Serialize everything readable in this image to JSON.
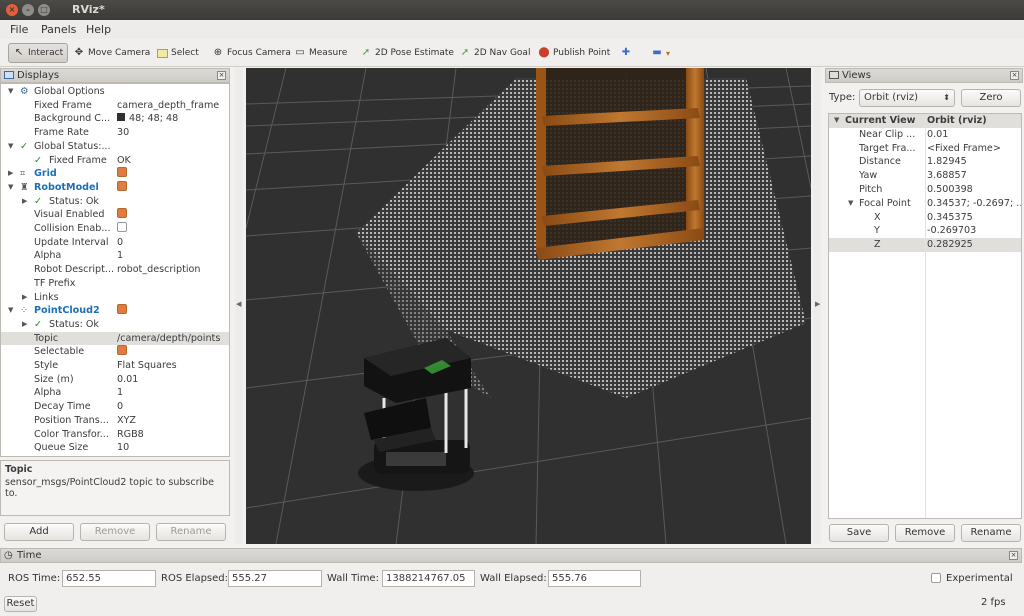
{
  "window": {
    "title": "RViz*"
  },
  "menu": [
    "File",
    "Panels",
    "Help"
  ],
  "toolbar": {
    "interact": "Interact",
    "move_camera": "Move Camera",
    "select": "Select",
    "focus_camera": "Focus Camera",
    "measure": "Measure",
    "pose_estimate": "2D Pose Estimate",
    "nav_goal": "2D Nav Goal",
    "publish_point": "Publish Point"
  },
  "displays": {
    "title": "Displays",
    "rows": [
      {
        "label": "Global Options",
        "value": ""
      },
      {
        "label": "Fixed Frame",
        "value": "camera_depth_frame"
      },
      {
        "label": "Background C...",
        "value": "48; 48; 48"
      },
      {
        "label": "Frame Rate",
        "value": "30"
      },
      {
        "label": "Global Status:...",
        "value": ""
      },
      {
        "label": "Fixed Frame",
        "value": "OK"
      },
      {
        "label": "Grid",
        "value": ""
      },
      {
        "label": "RobotModel",
        "value": ""
      },
      {
        "label": "Status: Ok",
        "value": ""
      },
      {
        "label": "Visual Enabled",
        "value": ""
      },
      {
        "label": "Collision Enab...",
        "value": ""
      },
      {
        "label": "Update Interval",
        "value": "0"
      },
      {
        "label": "Alpha",
        "value": "1"
      },
      {
        "label": "Robot Descript...",
        "value": "robot_description"
      },
      {
        "label": "TF Prefix",
        "value": ""
      },
      {
        "label": "Links",
        "value": ""
      },
      {
        "label": "PointCloud2",
        "value": ""
      },
      {
        "label": "Status: Ok",
        "value": ""
      },
      {
        "label": "Topic",
        "value": "/camera/depth/points"
      },
      {
        "label": "Selectable",
        "value": ""
      },
      {
        "label": "Style",
        "value": "Flat Squares"
      },
      {
        "label": "Size (m)",
        "value": "0.01"
      },
      {
        "label": "Alpha",
        "value": "1"
      },
      {
        "label": "Decay Time",
        "value": "0"
      },
      {
        "label": "Position Trans...",
        "value": "XYZ"
      },
      {
        "label": "Color Transfor...",
        "value": "RGB8"
      },
      {
        "label": "Queue Size",
        "value": "10"
      }
    ],
    "desc_title": "Topic",
    "desc_text": "sensor_msgs/PointCloud2 topic to subscribe to.",
    "buttons": {
      "add": "Add",
      "remove": "Remove",
      "rename": "Rename"
    }
  },
  "views": {
    "title": "Views",
    "type_label": "Type:",
    "type_value": "Orbit (rviz)",
    "zero": "Zero",
    "rows": [
      {
        "label": "Current View",
        "value": "Orbit (rviz)"
      },
      {
        "label": "Near Clip ...",
        "value": "0.01"
      },
      {
        "label": "Target Fra...",
        "value": "<Fixed Frame>"
      },
      {
        "label": "Distance",
        "value": "1.82945"
      },
      {
        "label": "Yaw",
        "value": "3.68857"
      },
      {
        "label": "Pitch",
        "value": "0.500398"
      },
      {
        "label": "Focal Point",
        "value": "0.34537; -0.2697; ..."
      },
      {
        "label": "X",
        "value": "0.345375"
      },
      {
        "label": "Y",
        "value": "-0.269703"
      },
      {
        "label": "Z",
        "value": "0.282925"
      }
    ],
    "buttons": {
      "save": "Save",
      "remove": "Remove",
      "rename": "Rename"
    }
  },
  "time": {
    "title": "Time",
    "ros_time_label": "ROS Time:",
    "ros_time": "652.55",
    "ros_elapsed_label": "ROS Elapsed:",
    "ros_elapsed": "555.27",
    "wall_time_label": "Wall Time:",
    "wall_time": "1388214767.05",
    "wall_elapsed_label": "Wall Elapsed:",
    "wall_elapsed": "555.76",
    "experimental": "Experimental",
    "reset": "Reset",
    "fps": "2 fps"
  },
  "colors": {
    "background": "#303030",
    "accent": "#e07b41",
    "title_blue": "#1d6fb8"
  }
}
